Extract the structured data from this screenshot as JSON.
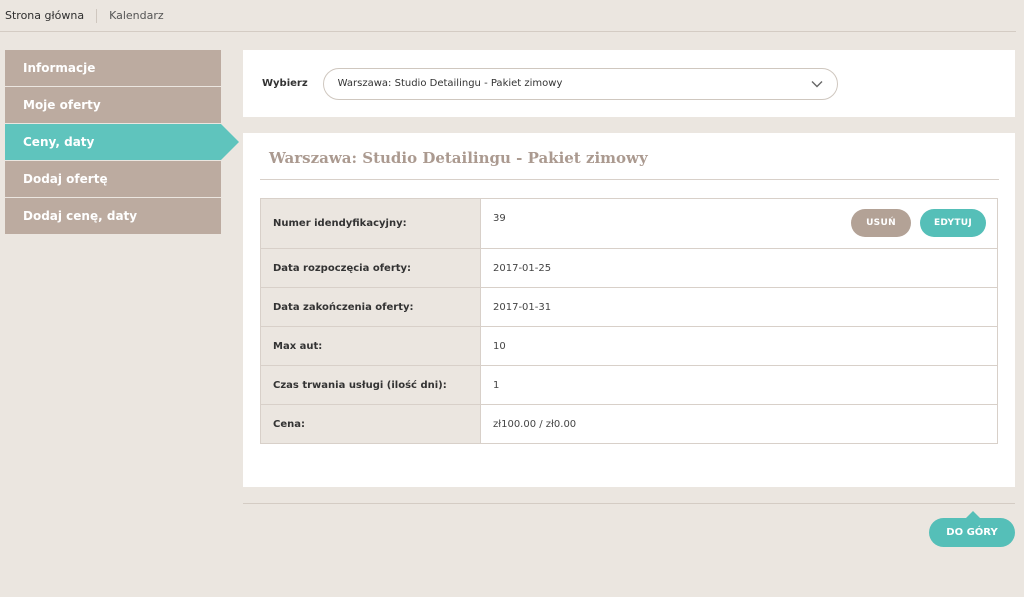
{
  "topnav": {
    "home": "Strona główna",
    "calendar": "Kalendarz"
  },
  "sidebar": {
    "items": [
      {
        "label": "Informacje"
      },
      {
        "label": "Moje oferty"
      },
      {
        "label": "Ceny, daty",
        "active": true
      },
      {
        "label": "Dodaj ofertę"
      },
      {
        "label": "Dodaj cenę, daty"
      }
    ]
  },
  "selector": {
    "label": "Wybierz",
    "value": "Warszawa: Studio Detailingu - Pakiet zimowy"
  },
  "offer": {
    "title": "Warszawa: Studio Detailingu - Pakiet zimowy",
    "rows": [
      {
        "label": "Numer idendyfikacyjny:",
        "value": "39"
      },
      {
        "label": "Data rozpoczęcia oferty:",
        "value": "2017-01-25"
      },
      {
        "label": "Data zakończenia oferty:",
        "value": "2017-01-31"
      },
      {
        "label": "Max aut:",
        "value": "10"
      },
      {
        "label": "Czas trwania usługi (ilość dni):",
        "value": "1"
      },
      {
        "label": "Cena:",
        "value": "zł100.00 / zł0.00"
      }
    ],
    "delete_label": "USUŃ",
    "edit_label": "EDYTUJ"
  },
  "back_to_top": "DO GÓRY",
  "colors": {
    "accent": "#5fc4bd",
    "sidebar": "#bcaba0",
    "title": "#ab9a90"
  },
  "icons": {
    "select_arrow": "chevron-down-icon"
  }
}
